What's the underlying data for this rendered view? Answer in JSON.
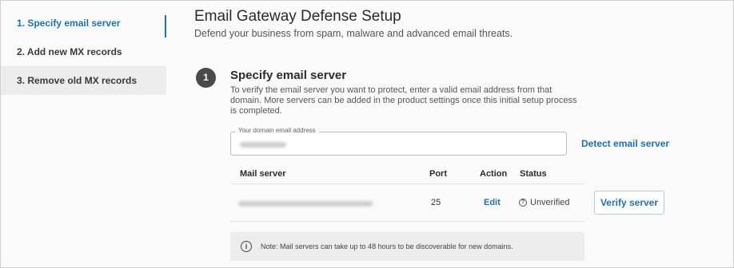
{
  "sidebar": {
    "items": [
      {
        "label": "1. Specify email server",
        "active": true
      },
      {
        "label": "2. Add new MX records",
        "active": false
      },
      {
        "label": "3. Remove old MX records",
        "active": false
      }
    ]
  },
  "header": {
    "title": "Email Gateway Defense Setup",
    "subtitle": "Defend your business from spam, malware and advanced email threats."
  },
  "section": {
    "step_number": "1",
    "title": "Specify email server",
    "description": "To verify the email server you want to protect, enter a valid email address from that domain. More servers can be added in the product settings once this initial setup process is completed."
  },
  "email_input": {
    "label": "Your domain email address",
    "value_redacted": true
  },
  "detect_link": "Detect email server",
  "table": {
    "headers": {
      "server": "Mail server",
      "port": "Port",
      "action": "Action",
      "status": "Status"
    },
    "rows": [
      {
        "server_redacted": true,
        "port": "25",
        "action": "Edit",
        "status": "Unverified",
        "status_icon": "question-circle-icon"
      }
    ]
  },
  "verify_button": "Verify server",
  "note": {
    "icon": "info-icon",
    "text": "Note: Mail servers can take up to 48 hours to be discoverable for new domains."
  },
  "colors": {
    "accent": "#1a73b8",
    "badge": "#4a4a4a",
    "note_bg": "#ececec"
  }
}
